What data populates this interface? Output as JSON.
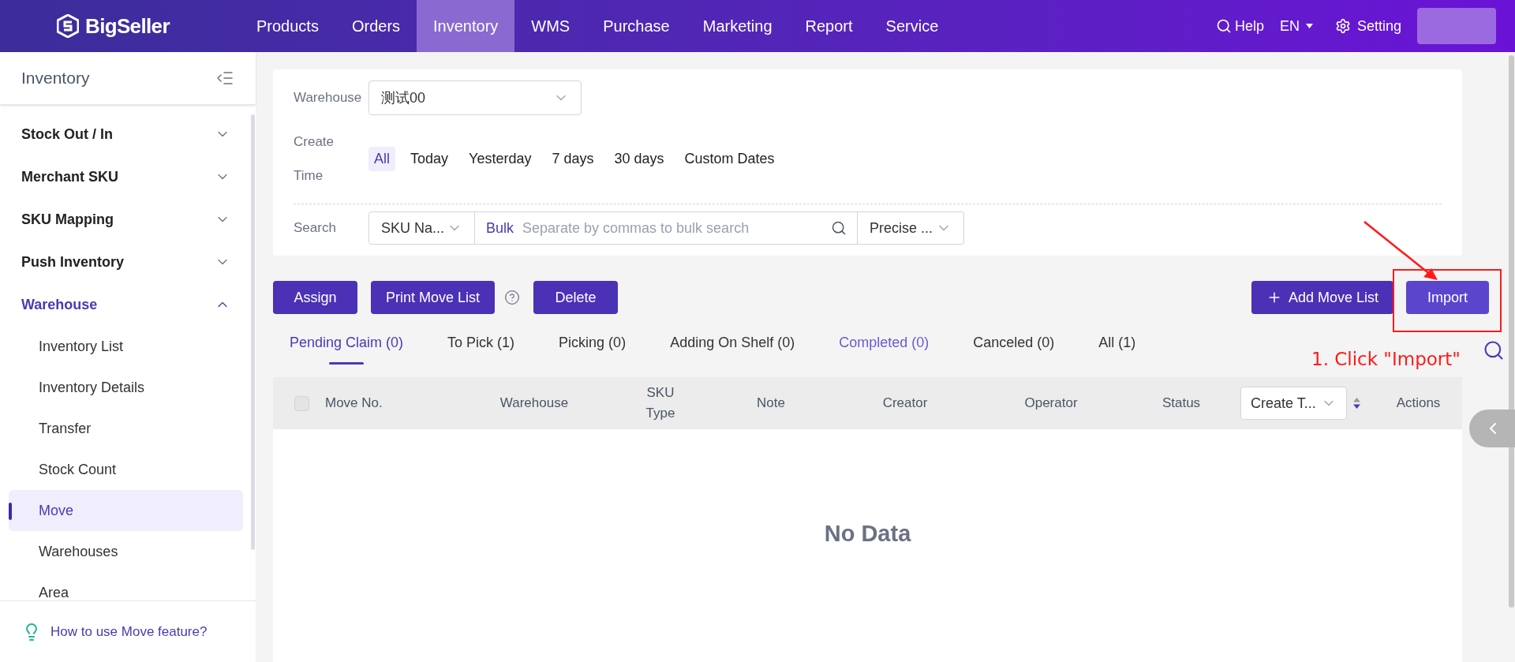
{
  "topbar": {
    "brand": "BigSeller",
    "items": [
      {
        "label": "Products",
        "selected": false
      },
      {
        "label": "Orders",
        "selected": false
      },
      {
        "label": "Inventory",
        "selected": true
      },
      {
        "label": "WMS",
        "selected": false
      },
      {
        "label": "Purchase",
        "selected": false
      },
      {
        "label": "Marketing",
        "selected": false
      },
      {
        "label": "Report",
        "selected": false
      },
      {
        "label": "Service",
        "selected": false
      }
    ],
    "help": "Help",
    "language": "EN",
    "setting": "Setting"
  },
  "sidebar": {
    "title": "Inventory",
    "groups": [
      {
        "label": "Stock Out / In",
        "expanded": false,
        "selected": false
      },
      {
        "label": "Merchant SKU",
        "expanded": false,
        "selected": false
      },
      {
        "label": "SKU Mapping",
        "expanded": false,
        "selected": false
      },
      {
        "label": "Push Inventory",
        "expanded": false,
        "selected": false
      },
      {
        "label": "Warehouse",
        "expanded": true,
        "selected": true,
        "children": [
          {
            "label": "Inventory List",
            "selected": false
          },
          {
            "label": "Inventory Details",
            "selected": false
          },
          {
            "label": "Transfer",
            "selected": false
          },
          {
            "label": "Stock Count",
            "selected": false
          },
          {
            "label": "Move",
            "selected": true
          },
          {
            "label": "Warehouses",
            "selected": false
          },
          {
            "label": "Area",
            "selected": false
          }
        ]
      }
    ],
    "help_link": "How to use Move feature?"
  },
  "filters": {
    "warehouse": {
      "label": "Warehouse",
      "value": "测试00"
    },
    "create_time": {
      "label": "Create Time",
      "options": [
        {
          "label": "All",
          "selected": true
        },
        {
          "label": "Today",
          "selected": false
        },
        {
          "label": "Yesterday",
          "selected": false
        },
        {
          "label": "7 days",
          "selected": false
        },
        {
          "label": "30 days",
          "selected": false
        },
        {
          "label": "Custom Dates",
          "selected": false
        }
      ]
    },
    "search": {
      "label": "Search",
      "field": "SKU Na...",
      "bulk": "Bulk",
      "placeholder": "Separate by commas to bulk search",
      "match": "Precise ..."
    }
  },
  "actions": {
    "left": [
      {
        "label": "Assign",
        "kind": "plain"
      },
      {
        "label": "Print Move List",
        "kind": "with-help"
      },
      {
        "label": "Delete",
        "kind": "plain"
      }
    ],
    "right": [
      {
        "label": "Add Move List",
        "kind": "add"
      },
      {
        "label": "Import",
        "kind": "plain"
      }
    ]
  },
  "tabs": [
    {
      "label": "Pending Claim (0)",
      "selected": true,
      "hovered": false
    },
    {
      "label": "To Pick (1)",
      "selected": false,
      "hovered": false
    },
    {
      "label": "Picking (0)",
      "selected": false,
      "hovered": false
    },
    {
      "label": "Adding On Shelf (0)",
      "selected": false,
      "hovered": false
    },
    {
      "label": "Completed (0)",
      "selected": false,
      "hovered": true
    },
    {
      "label": "Canceled (0)",
      "selected": false,
      "hovered": false
    },
    {
      "label": "All (1)",
      "selected": false,
      "hovered": false
    }
  ],
  "table": {
    "columns": [
      {
        "kind": "checkbox",
        "label": "Move No.",
        "checked": false
      },
      {
        "kind": "text",
        "label": "Warehouse"
      },
      {
        "kind": "text",
        "label": "SKU Type"
      },
      {
        "kind": "text",
        "label": "Note"
      },
      {
        "kind": "text",
        "label": "Creator"
      },
      {
        "kind": "text",
        "label": "Operator"
      },
      {
        "kind": "text",
        "label": "Status"
      },
      {
        "kind": "sort-select",
        "label": "Create T..."
      },
      {
        "kind": "text",
        "label": "Actions"
      }
    ],
    "empty": "No Data"
  },
  "annotation": {
    "text": "1. Click \"Import\""
  }
}
